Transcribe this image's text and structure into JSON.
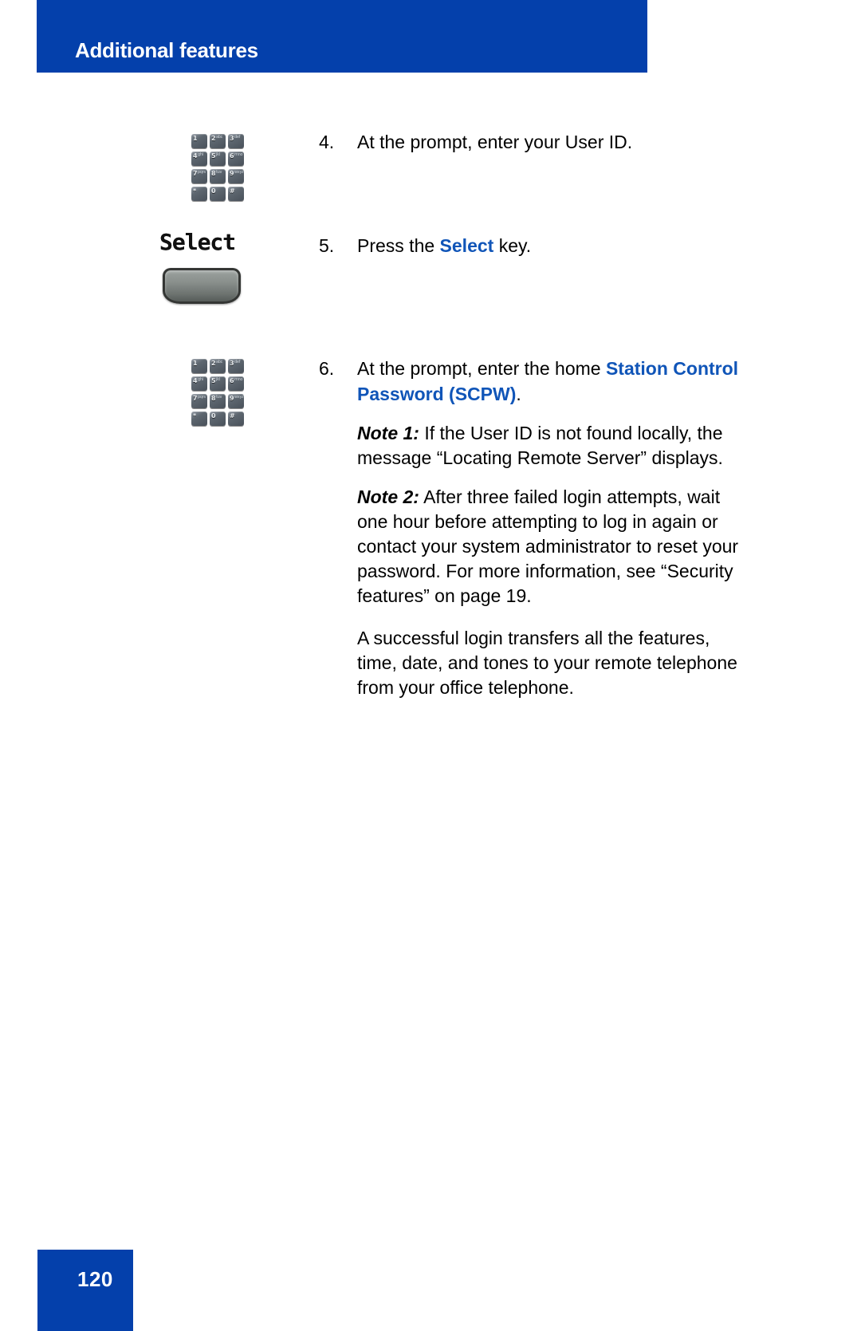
{
  "page": {
    "header_title": "Additional features",
    "page_number": "120",
    "accent_blue": "#0440ab",
    "link_blue": "#1055b8"
  },
  "icons": [
    {
      "name": "dialpad-icon",
      "position": "step-4"
    },
    {
      "name": "select-softkey-icon",
      "position": "step-5"
    },
    {
      "name": "dialpad-icon",
      "position": "step-6"
    }
  ],
  "softkey": {
    "label": "Select",
    "button_name": "select-soft-key-button"
  },
  "keypad": {
    "keys": [
      {
        "digit": "1",
        "letters": ""
      },
      {
        "digit": "2",
        "letters": "abc"
      },
      {
        "digit": "3",
        "letters": "def"
      },
      {
        "digit": "4",
        "letters": "ghi"
      },
      {
        "digit": "5",
        "letters": "jkl"
      },
      {
        "digit": "6",
        "letters": "mno"
      },
      {
        "digit": "7",
        "letters": "pqrs"
      },
      {
        "digit": "8",
        "letters": "tuv"
      },
      {
        "digit": "9",
        "letters": "wxyz"
      },
      {
        "digit": "*",
        "letters": ""
      },
      {
        "digit": "0",
        "letters": ""
      },
      {
        "digit": "#",
        "letters": ""
      }
    ]
  },
  "steps": [
    {
      "number": "4.",
      "text_before": "At the prompt, enter your User ID.",
      "keyword": "",
      "text_after": ""
    },
    {
      "number": "5.",
      "text_before": "Press the ",
      "keyword": "Select",
      "text_after": " key."
    },
    {
      "number": "6.",
      "text_before": "At the prompt, enter the home ",
      "keyword": "Station Control Password (SCPW)",
      "text_after": "."
    }
  ],
  "notes": [
    {
      "label": "Note 1:",
      "text": " If the User ID is not found locally, the message “Locating Remote Server” displays."
    },
    {
      "label": "Note 2:",
      "text": " After three failed login attempts, wait one hour before attempting to log in again or contact your system administrator to reset your password. For more information, see “Security features” on page 19."
    }
  ],
  "closing_paragraph": "A successful login transfers all the features, time, date, and tones to your remote telephone from your office telephone."
}
